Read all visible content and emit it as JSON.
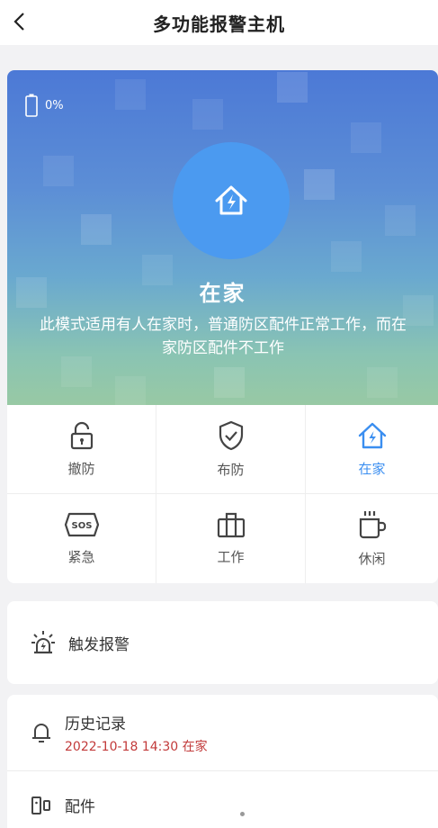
{
  "header": {
    "title": "多功能报警主机"
  },
  "status": {
    "battery_text": "0%"
  },
  "mode": {
    "name": "在家",
    "description": "此模式适用有人在家时，普通防区配件正常工作，而在家防区配件不工作"
  },
  "modes": [
    {
      "label": "撤防",
      "icon": "unlock-icon",
      "active": false
    },
    {
      "label": "布防",
      "icon": "shield-check-icon",
      "active": false
    },
    {
      "label": "在家",
      "icon": "home-bolt-icon",
      "active": true
    },
    {
      "label": "紧急",
      "icon": "sos-icon",
      "active": false
    },
    {
      "label": "工作",
      "icon": "briefcase-icon",
      "active": false
    },
    {
      "label": "休闲",
      "icon": "coffee-cup-icon",
      "active": false
    }
  ],
  "trigger": {
    "label": "触发报警",
    "icon": "alarm-light-icon"
  },
  "history": {
    "label": "历史记录",
    "last_entry": "2022-10-18 14:30 在家",
    "icon": "bell-icon"
  },
  "accessories": {
    "label": "配件",
    "icon": "device-icon"
  },
  "colors": {
    "accent": "#3a8ef0",
    "circle": "#4b9af0",
    "history_text": "#c23a3a"
  }
}
